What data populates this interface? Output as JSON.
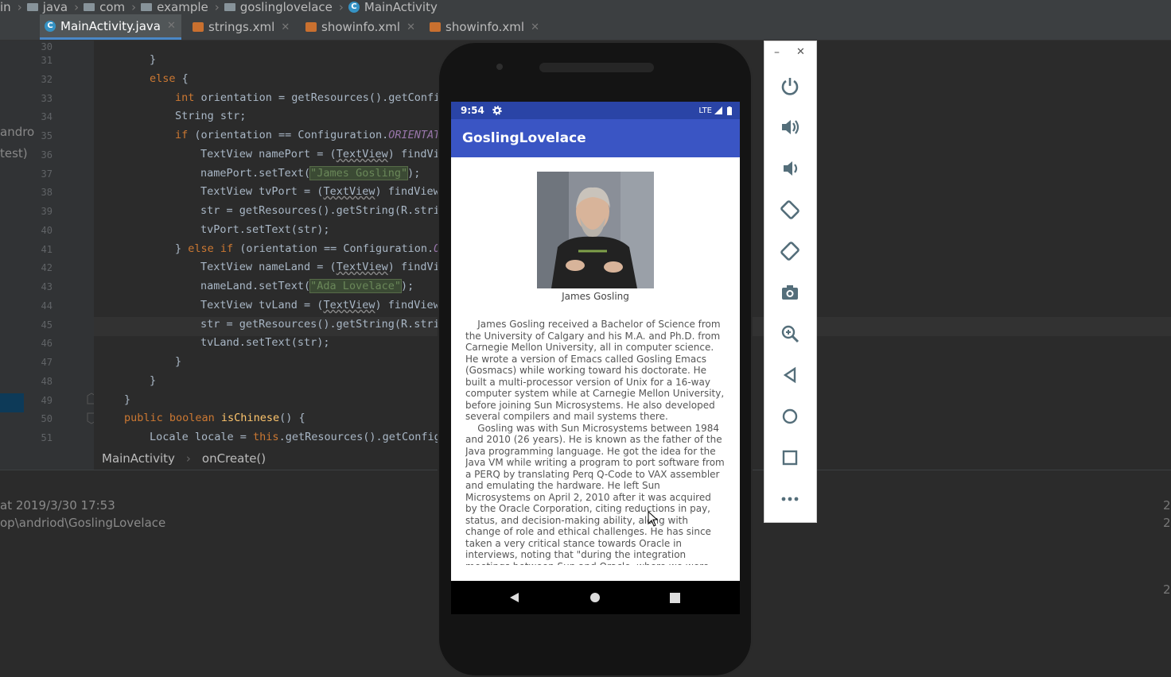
{
  "breadcrumb": {
    "items": [
      "in",
      "java",
      "com",
      "example",
      "goslinglovelace",
      "MainActivity"
    ]
  },
  "tabs": [
    {
      "label": "MainActivity.java",
      "active": true
    },
    {
      "label": "strings.xml",
      "active": false
    },
    {
      "label": "showinfo.xml",
      "active": false
    },
    {
      "label": "showinfo.xml",
      "active": false
    }
  ],
  "left_panel": {
    "line1": "andro",
    "line2": "test)"
  },
  "editor": {
    "line_numbers": [
      "30",
      "31",
      "32",
      "33",
      "34",
      "35",
      "36",
      "37",
      "38",
      "39",
      "40",
      "41",
      "42",
      "43",
      "44",
      "45",
      "46",
      "47",
      "48",
      "49",
      "50",
      "51"
    ],
    "code": {
      "l31": "}",
      "l32_kw": "else",
      "l32_rest": " {",
      "l33_kw": "int",
      "l33_rest": " orientation = getResources().getConfi",
      "l34": "String str;",
      "l35_kw": "if",
      "l35_a": " (orientation == Configuration.",
      "l35_it": "ORIENTAT",
      "l36_a": "TextView namePort = (",
      "l36_u": "TextView",
      "l36_b": ") findVi",
      "l37_a": "namePort.setText(",
      "l37_str": "\"James Gosling\"",
      "l37_b": ");",
      "l38_a": "TextView tvPort = (",
      "l38_u": "TextView",
      "l38_b": ") findView",
      "l39": "str = getResources().getString(R.stri",
      "l40": "tvPort.setText(str);",
      "l41_a": "} ",
      "l41_kw": "else if",
      "l41_b": " (orientation == Configuration.",
      "l41_it": "O",
      "l42_a": "TextView nameLand = (",
      "l42_u": "TextView",
      "l42_b": ") findVi",
      "l43_a": "nameLand.setText(",
      "l43_str": "\"Ada Lovelace\"",
      "l43_b": ");",
      "l44_a": "TextView tvLand = (",
      "l44_u": "TextView",
      "l44_b": ") findView",
      "l45": "str = getResources().getString(R.stri",
      "l46": "tvLand.setText(str);",
      "l47": "}",
      "l48": "}",
      "l49": "}",
      "l50_kw": "public boolean",
      "l50_fn": " isChinese",
      "l50_b": "() {",
      "l51_a": "Locale locale = ",
      "l51_kw": "this",
      "l51_b": ".getResources().getConfig"
    },
    "method_crumbs": [
      "MainActivity",
      "onCreate()"
    ]
  },
  "bottom_panel": {
    "line1": "at 2019/3/30 17:53",
    "line2": "op\\andriod\\GoslingLovelace",
    "right_num": "2"
  },
  "phone": {
    "time": "9:54",
    "network": "LTE",
    "app_title": "GoslingLovelace",
    "photo_caption": "James Gosling",
    "bio": "    James Gosling received a Bachelor of Science from the University of Calgary and his M.A. and Ph.D. from Carnegie Mellon University, all in computer science. He wrote a version of Emacs called Gosling Emacs (Gosmacs) while working toward his doctorate. He built a multi-processor version of Unix for a 16-way computer system while at Carnegie Mellon University, before joining Sun Microsystems. He also developed several compilers and mail systems there.\n    Gosling was with Sun Microsystems between 1984 and 2010 (26 years). He is known as the father of the Java programming language. He got the idea for the Java VM while writing a program to port software from a PERQ by translating Perq Q-Code to VAX assembler and emulating the hardware. He left Sun Microsystems on April 2, 2010 after it was acquired by the Oracle Corporation, citing reductions in pay, status, and decision-making ability, along with change of role and ethical challenges. He has since taken a very critical stance towards Oracle in interviews, noting that \"during the integration meetings between Sun and Oracle, where we were being grilled about the patent situation between Sun and Google, we could see the Oracle"
  },
  "emulator_controls": [
    "power-icon",
    "volume-up-icon",
    "volume-down-icon",
    "rotate-left-icon",
    "rotate-right-icon",
    "camera-icon",
    "zoom-icon",
    "back-icon",
    "home-icon",
    "overview-icon",
    "more-icon"
  ],
  "colors": {
    "ide_bg": "#2b2b2b",
    "app_bar": "#3a55c4",
    "status_bar": "#2a44a6"
  }
}
